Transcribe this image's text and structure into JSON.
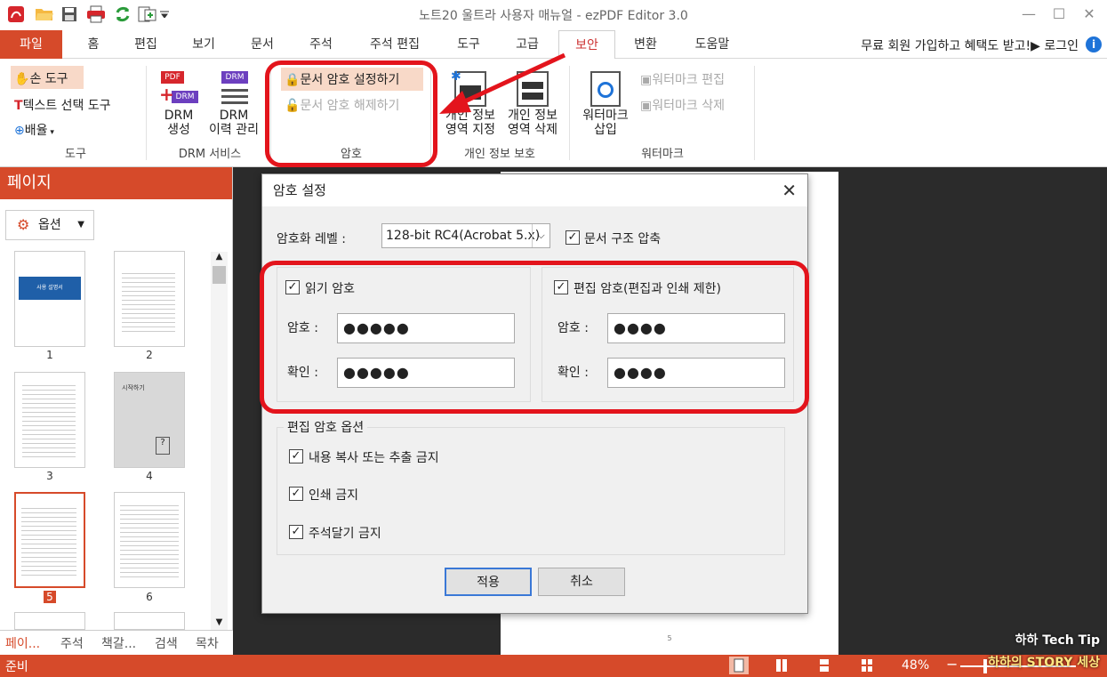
{
  "app": {
    "title": "노트20 울트라 사용자 매뉴얼 - ezPDF Editor 3.0"
  },
  "menu": {
    "tabs": [
      "파일",
      "홈",
      "편집",
      "보기",
      "문서",
      "주석",
      "주석 편집",
      "도구",
      "고급",
      "보안",
      "변환",
      "도움말"
    ],
    "active": "보안",
    "right_text": "무료 회원 가입하고 혜택도 받고!▶ 로그인"
  },
  "ribbon": {
    "tools": {
      "hand": "손 도구",
      "text_select": "텍스트 선택 도구",
      "zoom": "배율",
      "label": "도구"
    },
    "drm": {
      "create_line1": "DRM",
      "create_line2": "생성",
      "history_line1": "DRM",
      "history_line2": "이력 관리",
      "label": "DRM 서비스",
      "pdf_badge": "PDF",
      "drm_badge": "DRM"
    },
    "password": {
      "set": "문서 암호 설정하기",
      "unset": "문서 암호 해제하기",
      "label": "암호"
    },
    "privacy": {
      "specify_line1": "개인 정보",
      "specify_line2": "영역 지정",
      "delete_line1": "개인 정보",
      "delete_line2": "영역 삭제",
      "label": "개인 정보 보호"
    },
    "watermark": {
      "insert_line1": "워터마크",
      "insert_line2": "삽입",
      "edit": "워터마크 편집",
      "delete": "워터마크 삭제",
      "label": "워터마크"
    }
  },
  "leftpane": {
    "header": "페이지",
    "options": "옵션",
    "thumbnails": [
      "1",
      "2",
      "3",
      "4",
      "5",
      "6"
    ],
    "selected_page": "5",
    "thumb1_title": "사용 설명서",
    "thumb4_title": "시작하기",
    "bottom_tabs": [
      "페이...",
      "주석",
      "책갈...",
      "검색",
      "목차"
    ]
  },
  "document": {
    "page_number": "5"
  },
  "dialog": {
    "title": "암호 설정",
    "encryption_label": "암호화 레벨 :",
    "encryption_value": "128-bit RC4(Acrobat 5.x)",
    "compress_label": "문서 구조 압축",
    "compress_checked": true,
    "read_password": {
      "label": "읽기 암호",
      "checked": true,
      "password_label": "암호 :",
      "password_value": "●●●●●",
      "confirm_label": "확인 :",
      "confirm_value": "●●●●●"
    },
    "edit_password": {
      "label": "편집 암호(편집과 인쇄 제한)",
      "checked": true,
      "password_label": "암호 :",
      "password_value": "●●●●",
      "confirm_label": "확인 :",
      "confirm_value": "●●●●"
    },
    "edit_options": {
      "title": "편집 암호 옵션",
      "items": [
        {
          "label": "내용 복사 또는 추출 금지",
          "checked": true
        },
        {
          "label": "인쇄 금지",
          "checked": true
        },
        {
          "label": "주석달기 금지",
          "checked": true
        }
      ]
    },
    "apply": "적용",
    "cancel": "취소"
  },
  "status": {
    "text": "준비",
    "zoom": "48%"
  },
  "watermark_overlay": {
    "line1": "하하 Tech Tip",
    "line2": "하하의 STORY 세상"
  },
  "colors": {
    "accent": "#d64a2a",
    "annotation_red": "#e3141c",
    "primary_button_border": "#3a78d6"
  }
}
